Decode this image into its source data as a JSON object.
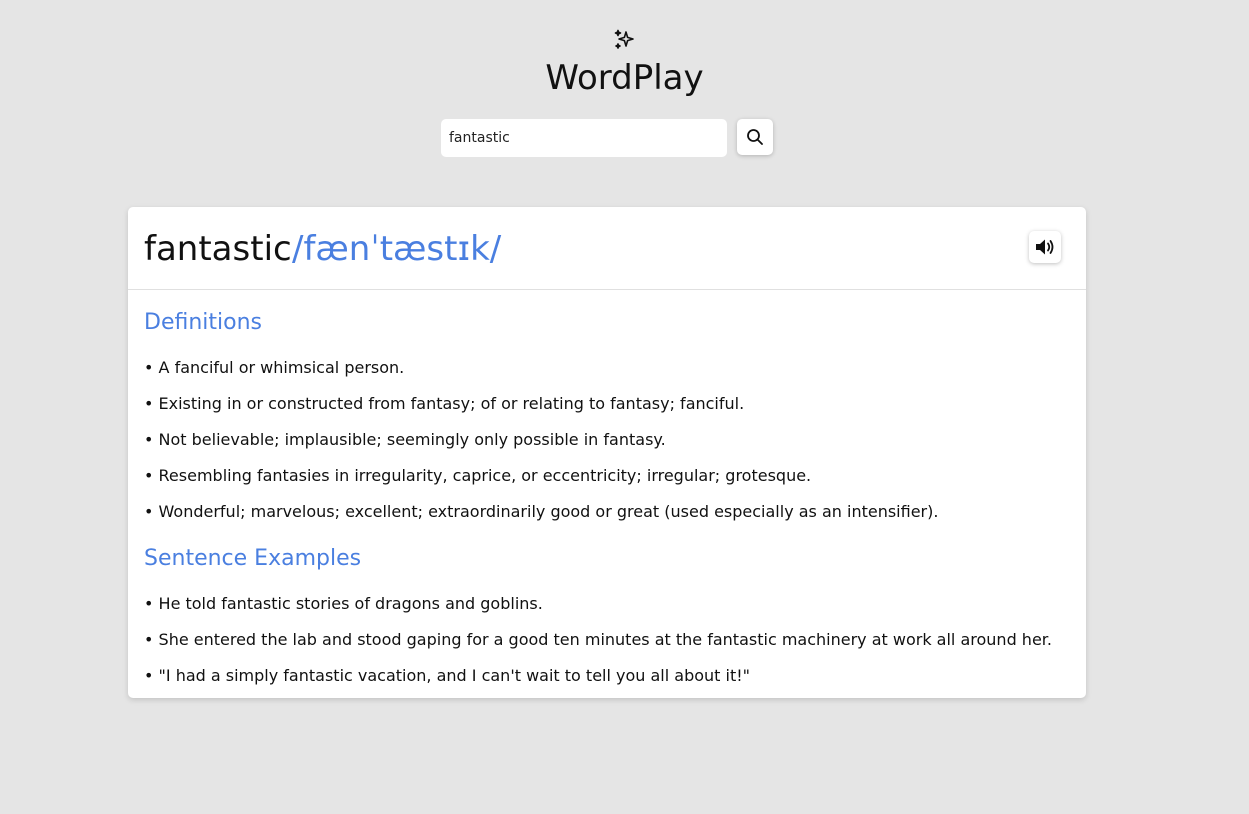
{
  "app": {
    "title": "WordPlay",
    "logo_icon": "sparkles-icon"
  },
  "search": {
    "value": "fantastic",
    "placeholder": "",
    "button_icon": "search-icon"
  },
  "result": {
    "word": "fantastic",
    "phonetic": "/fænˈtæstɪk/",
    "audio_icon": "speaker-icon",
    "definitions_title": "Definitions",
    "definitions": [
      "A fanciful or whimsical person.",
      "Existing in or constructed from fantasy; of or relating to fantasy; fanciful.",
      "Not believable; implausible; seemingly only possible in fantasy.",
      "Resembling fantasies in irregularity, caprice, or eccentricity; irregular; grotesque.",
      "Wonderful; marvelous; excellent; extraordinarily good or great (used especially as an intensifier)."
    ],
    "examples_title": "Sentence Examples",
    "examples": [
      "He told fantastic stories of dragons and goblins.",
      "She entered the lab and stood gaping for a good ten minutes at the fantastic machinery at work all around her.",
      "\"I had a simply fantastic vacation, and I can't wait to tell you all about it!\""
    ]
  },
  "colors": {
    "background": "#e5e5e5",
    "accent": "#4a7fe0",
    "card": "#ffffff"
  }
}
